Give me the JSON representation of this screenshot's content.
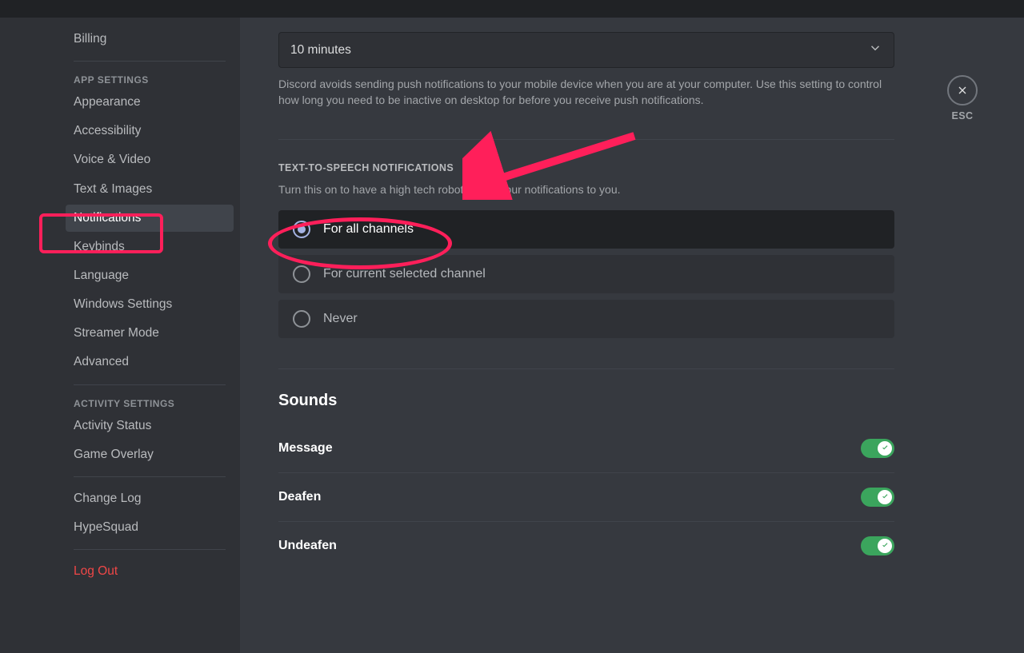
{
  "sidebar": {
    "billing": "Billing",
    "app_settings_header": "App Settings",
    "appearance": "Appearance",
    "accessibility": "Accessibility",
    "voice_video": "Voice & Video",
    "text_images": "Text & Images",
    "notifications": "Notifications",
    "keybinds": "Keybinds",
    "language": "Language",
    "windows_settings": "Windows Settings",
    "streamer_mode": "Streamer Mode",
    "advanced": "Advanced",
    "activity_settings_header": "Activity Settings",
    "activity_status": "Activity Status",
    "game_overlay": "Game Overlay",
    "change_log": "Change Log",
    "hypesquad": "HypeSquad",
    "log_out": "Log Out"
  },
  "push_timeout": {
    "value": "10 minutes",
    "help": "Discord avoids sending push notifications to your mobile device when you are at your computer. Use this setting to control how long you need to be inactive on desktop for before you receive push notifications."
  },
  "tts": {
    "header": "Text-to-Speech Notifications",
    "help": "Turn this on to have a high tech robot speak your notifications to you.",
    "opt_all": "For all channels",
    "opt_current": "For current selected channel",
    "opt_never": "Never"
  },
  "sounds": {
    "header": "Sounds",
    "items": [
      {
        "label": "Message"
      },
      {
        "label": "Deafen"
      },
      {
        "label": "Undeafen"
      }
    ]
  },
  "close": {
    "esc": "ESC"
  }
}
